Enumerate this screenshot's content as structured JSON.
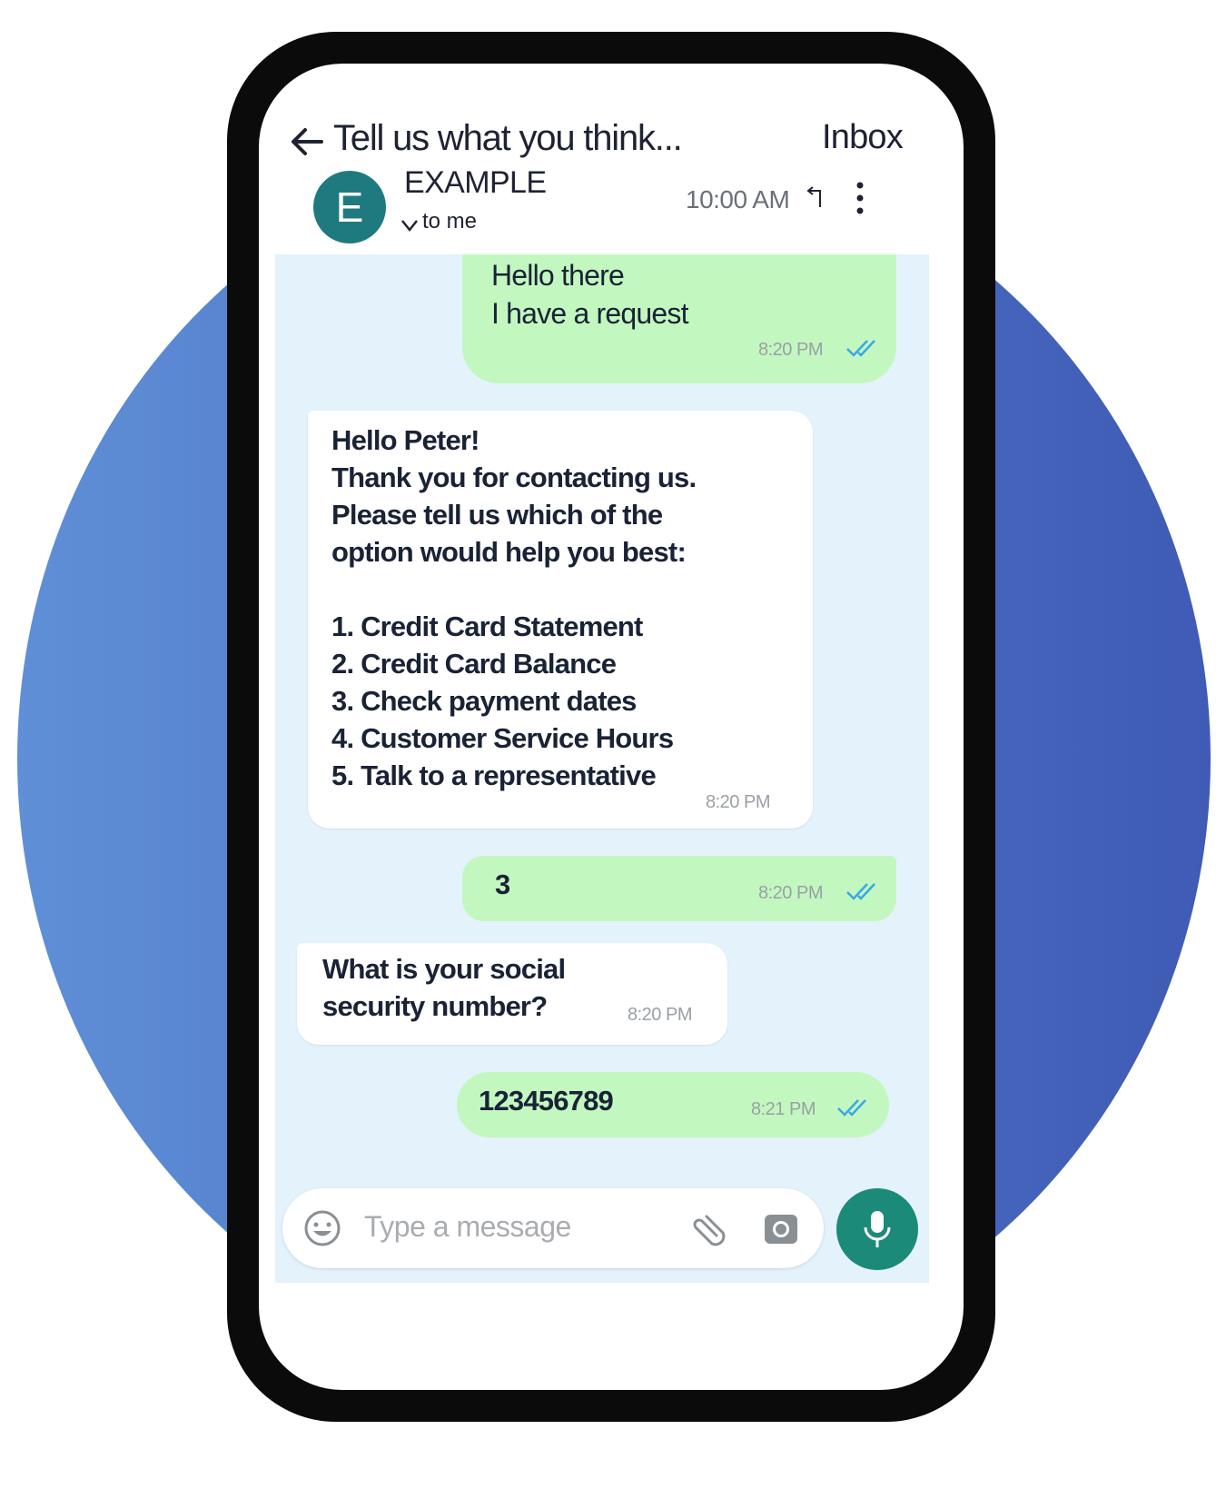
{
  "header": {
    "subject": "Tell us what you think...",
    "inbox_label": "Inbox",
    "avatar_letter": "E",
    "sender": "EXAMPLE",
    "recipient": "to me",
    "time": "10:00 AM"
  },
  "messages": [
    {
      "direction": "outgoing",
      "text": "Hello there\nI have a request",
      "time": "8:20 PM",
      "read": true
    },
    {
      "direction": "incoming",
      "text": "Hello Peter!\nThank you for contacting us.\nPlease tell us which of the\noption would help you best:\n\n1. Credit Card Statement\n2. Credit Card Balance\n3. Check payment dates\n4. Customer Service Hours\n5. Talk to a representative",
      "time": "8:20 PM"
    },
    {
      "direction": "outgoing",
      "text": "3",
      "time": "8:20 PM",
      "read": true
    },
    {
      "direction": "incoming",
      "text": "What is your social\nsecurity number?",
      "time": "8:20 PM"
    },
    {
      "direction": "outgoing",
      "text": "123456789",
      "time": "8:21 PM",
      "read": true
    }
  ],
  "composer": {
    "placeholder": "Type a message",
    "icons": [
      "emoji-icon",
      "paperclip-icon",
      "camera-icon",
      "microphone-icon"
    ]
  },
  "colors": {
    "background_circle": "#4f74c6",
    "outgoing_bubble": "#c2f8c0",
    "incoming_bubble": "#ffffff",
    "chat_background": "#e3f2fb",
    "avatar": "#1f7a80",
    "mic_button": "#1c8a78",
    "read_ticks": "#3aa6e6"
  }
}
